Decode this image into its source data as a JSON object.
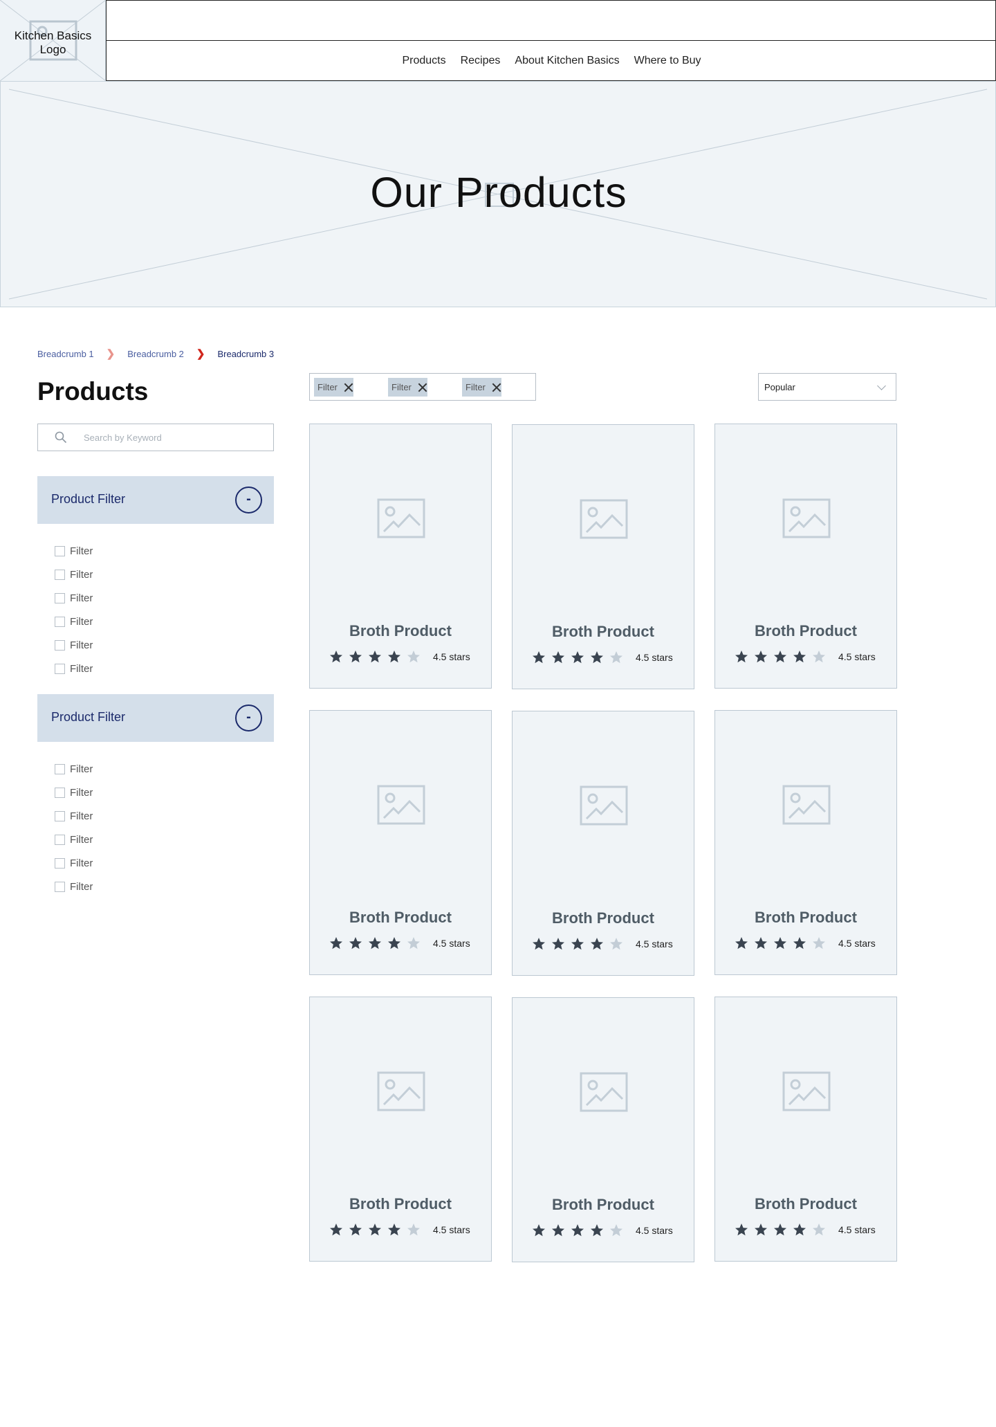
{
  "header": {
    "logo_text": "Kitchen Basics Logo",
    "nav": [
      "Products",
      "Recipes",
      "About Kitchen Basics",
      "Where to Buy"
    ]
  },
  "hero": {
    "title": "Our Products"
  },
  "breadcrumb": [
    "Breadcrumb 1",
    "Breadcrumb 2",
    "Breadcrumb 3"
  ],
  "sidebar": {
    "title": "Products",
    "search_placeholder": "Search by Keyword",
    "filter_groups": [
      {
        "label": "Product Filter",
        "toggle": "-",
        "options": [
          "Filter",
          "Filter",
          "Filter",
          "Filter",
          "Filter",
          "Filter"
        ]
      },
      {
        "label": "Product Filter",
        "toggle": "-",
        "options": [
          "Filter",
          "Filter",
          "Filter",
          "Filter",
          "Filter",
          "Filter"
        ]
      }
    ]
  },
  "active_filters": [
    "Filter",
    "Filter",
    "Filter"
  ],
  "sort": {
    "selected": "Popular"
  },
  "products": [
    {
      "name": "Broth Product",
      "rating": 4,
      "rating_label": "4.5 stars"
    },
    {
      "name": "Broth Product",
      "rating": 4,
      "rating_label": "4.5 stars"
    },
    {
      "name": "Broth Product",
      "rating": 4,
      "rating_label": "4.5 stars"
    },
    {
      "name": "Broth Product",
      "rating": 4,
      "rating_label": "4.5 stars"
    },
    {
      "name": "Broth Product",
      "rating": 4,
      "rating_label": "4.5 stars"
    },
    {
      "name": "Broth Product",
      "rating": 4,
      "rating_label": "4.5 stars"
    },
    {
      "name": "Broth Product",
      "rating": 4,
      "rating_label": "4.5 stars"
    },
    {
      "name": "Broth Product",
      "rating": 4,
      "rating_label": "4.5 stars"
    },
    {
      "name": "Broth Product",
      "rating": 4,
      "rating_label": "4.5 stars"
    }
  ],
  "colors": {
    "accent": "#1b2a6b",
    "filter_header_bg": "#d4dfea",
    "placeholder_bg": "#f0f4f7",
    "star_filled": "#3a4450",
    "star_empty": "#c3cdd6",
    "breadcrumb_separator": "#d0261c"
  }
}
